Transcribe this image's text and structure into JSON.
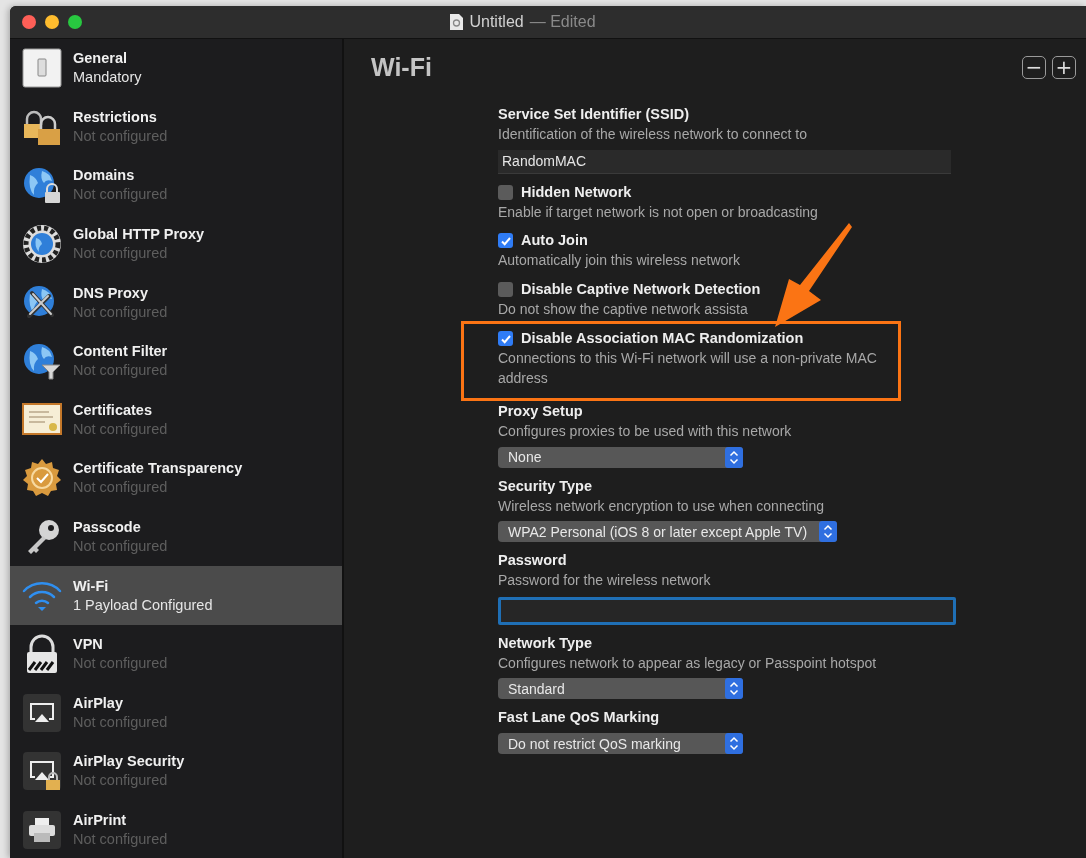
{
  "window": {
    "title": "Untitled",
    "status": "— Edited"
  },
  "sidebar": {
    "items": [
      {
        "name": "General",
        "status": "Mandatory",
        "configured": true,
        "selected": false
      },
      {
        "name": "Restrictions",
        "status": "Not configured",
        "configured": false,
        "selected": false
      },
      {
        "name": "Domains",
        "status": "Not configured",
        "configured": false,
        "selected": false
      },
      {
        "name": "Global HTTP Proxy",
        "status": "Not configured",
        "configured": false,
        "selected": false
      },
      {
        "name": "DNS Proxy",
        "status": "Not configured",
        "configured": false,
        "selected": false
      },
      {
        "name": "Content Filter",
        "status": "Not configured",
        "configured": false,
        "selected": false
      },
      {
        "name": "Certificates",
        "status": "Not configured",
        "configured": false,
        "selected": false
      },
      {
        "name": "Certificate Transparency",
        "status": "Not configured",
        "configured": false,
        "selected": false
      },
      {
        "name": "Passcode",
        "status": "Not configured",
        "configured": false,
        "selected": false
      },
      {
        "name": "Wi-Fi",
        "status": "1 Payload Configured",
        "configured": true,
        "selected": true
      },
      {
        "name": "VPN",
        "status": "Not configured",
        "configured": false,
        "selected": false
      },
      {
        "name": "AirPlay",
        "status": "Not configured",
        "configured": false,
        "selected": false
      },
      {
        "name": "AirPlay Security",
        "status": "Not configured",
        "configured": false,
        "selected": false
      },
      {
        "name": "AirPrint",
        "status": "Not configured",
        "configured": false,
        "selected": false
      }
    ]
  },
  "payload": {
    "title": "Wi-Fi",
    "buttons": [
      "−",
      "+"
    ],
    "fields": [
      {
        "kind": "text",
        "label": "Service Set Identifier (SSID)",
        "description": "Identification of the wireless network to connect to",
        "value": "RandomMAC",
        "highlighted": false
      },
      {
        "kind": "checkbox",
        "label": "Hidden Network",
        "description": "Enable if target network is not open or broadcasting",
        "checked": false,
        "highlighted": false
      },
      {
        "kind": "checkbox",
        "label": "Auto Join",
        "description": "Automatically join this wireless network",
        "checked": true,
        "highlighted": false
      },
      {
        "kind": "checkbox",
        "label": "Disable Captive Network Detection",
        "description": "Do not show the captive network assista",
        "checked": false,
        "highlighted": false
      },
      {
        "kind": "checkbox",
        "label": "Disable Association MAC Randomization",
        "description": "Connections to this Wi-Fi network will use a non-private MAC address",
        "checked": true,
        "highlighted": true
      },
      {
        "kind": "popup",
        "label": "Proxy Setup",
        "description": "Configures proxies to be used with this network",
        "value": "None",
        "highlighted": false
      },
      {
        "kind": "popup",
        "label": "Security Type",
        "description": "Wireless network encryption to use when connecting",
        "value": "WPA2 Personal (iOS 8 or later except Apple TV)",
        "highlighted": false
      },
      {
        "kind": "password",
        "label": "Password",
        "description": "Password for the wireless network",
        "focused": true,
        "highlighted": false
      },
      {
        "kind": "popup",
        "label": "Network Type",
        "description": "Configures network to appear as legacy or Passpoint hotspot",
        "value": "Standard",
        "highlighted": false
      },
      {
        "kind": "popup",
        "label": "Fast Lane QoS Marking",
        "value": "Do not restrict QoS marking",
        "highlighted": false
      }
    ]
  }
}
